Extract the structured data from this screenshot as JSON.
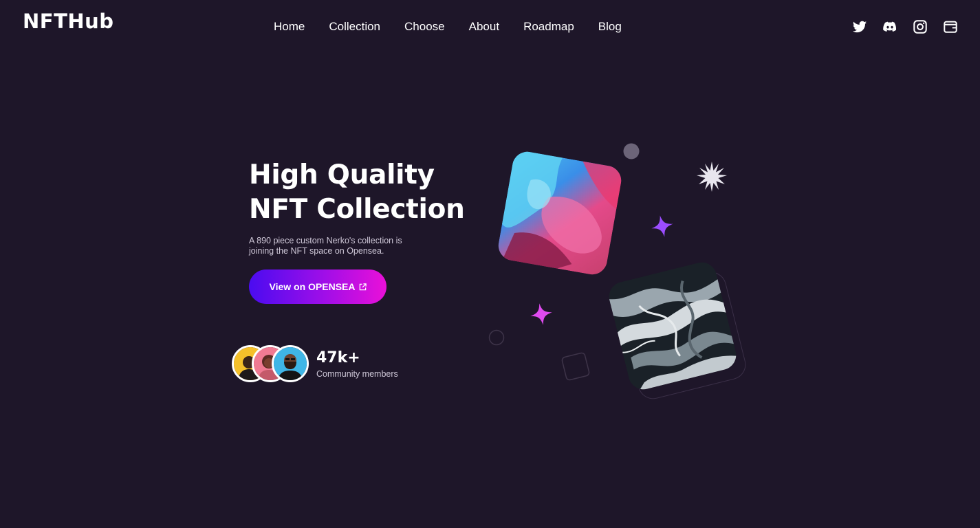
{
  "brand": {
    "logo": "NFTHub"
  },
  "nav": {
    "items": [
      "Home",
      "Collection",
      "Choose",
      "About",
      "Roadmap",
      "Blog"
    ]
  },
  "socials": [
    "twitter-icon",
    "discord-icon",
    "instagram-icon",
    "wallet-icon"
  ],
  "hero": {
    "title_line1": "High Quality",
    "title_line2": "NFT Collection",
    "description": "A 890 piece custom Nerko's collection is joining the NFT space on Opensea.",
    "cta_label": "View on OPENSEA"
  },
  "community": {
    "count": "47k+",
    "label": "Community members"
  },
  "colors": {
    "background": "#1e1629",
    "accent_start": "#4a0cf0",
    "accent_end": "#ea10d8",
    "sparkle_purple": "#9b4dff",
    "sparkle_pink": "#e04bf0"
  }
}
